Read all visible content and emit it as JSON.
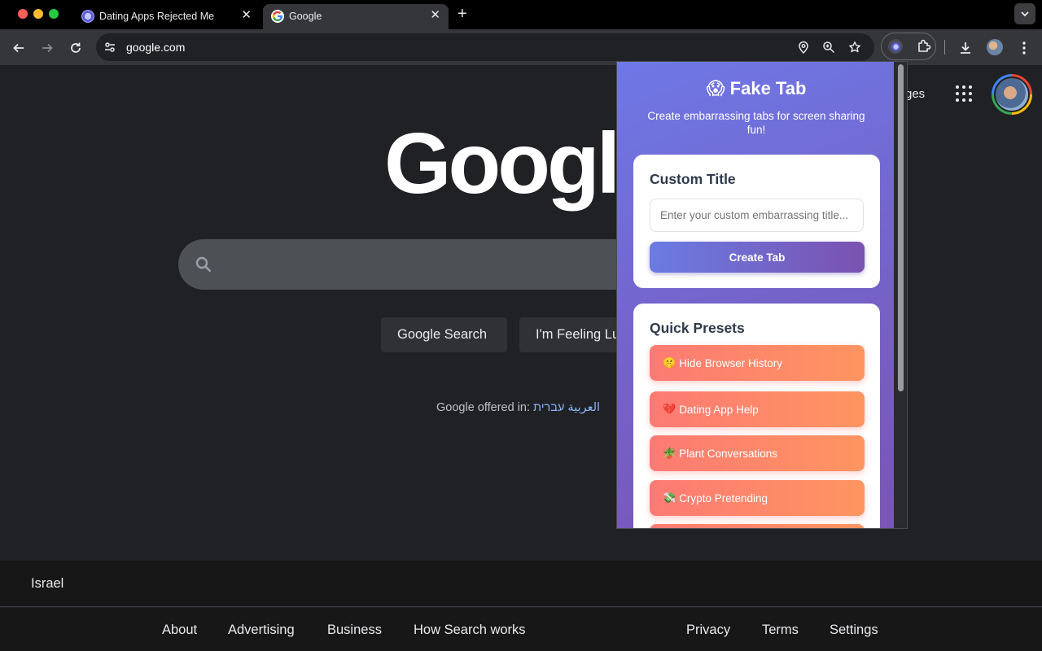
{
  "browser": {
    "tabs": [
      {
        "title": "Dating Apps Rejected Me",
        "favicon": "extension-icon",
        "active": false
      },
      {
        "title": "Google",
        "favicon": "google-icon",
        "active": true
      }
    ],
    "new_tab_symbol": "+",
    "close_symbol": "✕",
    "address": "google.com"
  },
  "google": {
    "logo_text": "Google",
    "images_link_partial": "ges",
    "search_button": "Google Search",
    "lucky_button": "I'm Feeling Lucky",
    "offered_in_label": "Google offered in:",
    "offered_languages": "العربية עברית",
    "country": "Israel",
    "footer_left": [
      "About",
      "Advertising",
      "Business",
      "How Search works"
    ],
    "footer_right": [
      "Privacy",
      "Terms",
      "Settings"
    ]
  },
  "popup": {
    "title_emoji": "😱",
    "title": "Fake Tab",
    "subtitle": "Create embarrassing tabs for screen sharing fun!",
    "custom": {
      "heading": "Custom Title",
      "placeholder": "Enter your custom embarrassing title...",
      "button": "Create Tab"
    },
    "presets": {
      "heading": "Quick Presets",
      "items": [
        {
          "emoji": "🤫",
          "label": "Hide Browser History"
        },
        {
          "emoji": "💔",
          "label": "Dating App Help"
        },
        {
          "emoji": "🪴",
          "label": "Plant Conversations"
        },
        {
          "emoji": "💸",
          "label": "Crypto Pretending"
        }
      ]
    }
  },
  "colors": {
    "popup_gradient_start": "#6e78e6",
    "popup_gradient_end": "#7a55b4",
    "preset_start": "#fd7a74",
    "preset_end": "#fe9560",
    "page_bg": "#202124"
  }
}
